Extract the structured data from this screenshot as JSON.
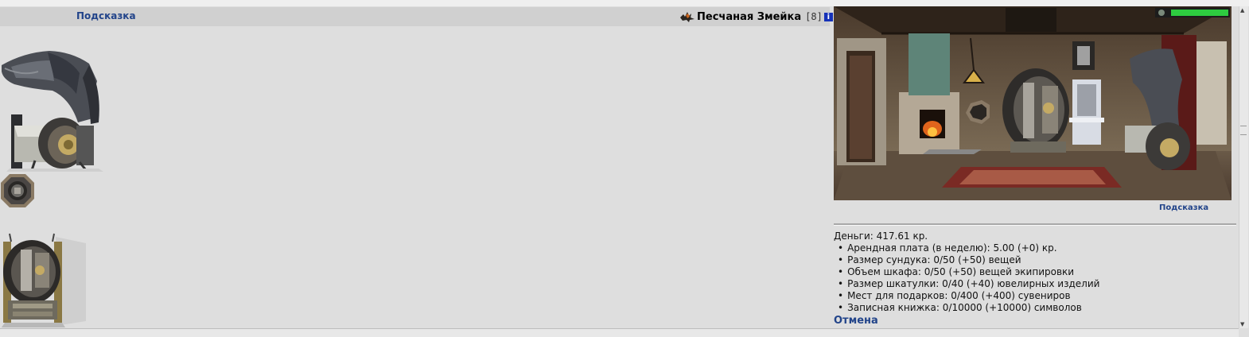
{
  "header": {
    "hint_link": "Подсказка",
    "player": {
      "name": "Песчаная Змейка",
      "level": "[8]",
      "info_badge": "i",
      "alignment_icon": "dark-alignment-icon"
    }
  },
  "items": [
    {
      "name": "canopy-chest"
    },
    {
      "name": "jewelry-box"
    },
    {
      "name": "wardrobe"
    }
  ],
  "scene": {
    "hint_link": "Подсказка",
    "health_bar": 1.0
  },
  "info": {
    "money": "Деньги: 417.61 кр.",
    "lines": [
      "Арендная плата (в неделю): 5.00 (+0) кр.",
      "Размер сундука: 0/50 (+50) вещей",
      "Объем шкафа: 0/50 (+50) вещей экипировки",
      "Размер шкатулки: 0/40 (+40) ювелирных изделий",
      "Мест для подарков: 0/400 (+400) сувениров",
      "Записная книжка: 0/10000 (+10000) символов"
    ],
    "cancel_link": "Отмена"
  },
  "colors": {
    "background": "#dedede",
    "header_bar": "#d0d0d0",
    "link": "#22448a",
    "info_badge": "#1632b8",
    "health": "#2ecc40"
  }
}
